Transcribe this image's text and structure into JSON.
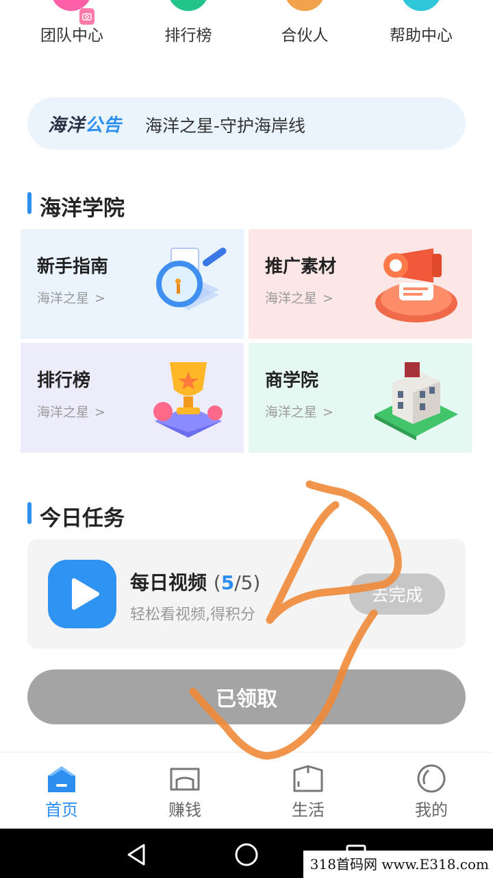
{
  "top_nav": {
    "items": [
      {
        "label": "团队中心",
        "color": "#ff5fa6"
      },
      {
        "label": "排行榜",
        "color": "#22c48a"
      },
      {
        "label": "合伙人",
        "color": "#f2a24a"
      },
      {
        "label": "帮助中心",
        "color": "#2ec6d8"
      }
    ],
    "badge_icon": "camera-badge-icon"
  },
  "notice": {
    "brand_part1": "海洋",
    "brand_part2": "公告",
    "text": "海洋之星-守护海岸线"
  },
  "academy": {
    "title": "海洋学院",
    "cards": [
      {
        "title": "新手指南",
        "sub": "海洋之星",
        "bg": "#eaf4fd",
        "icon": "magnifier-document-icon"
      },
      {
        "title": "推广素材",
        "sub": "海洋之星",
        "bg": "#fde6e6",
        "icon": "megaphone-icon"
      },
      {
        "title": "排行榜",
        "sub": "海洋之星",
        "bg": "#ececfb",
        "icon": "trophy-icon"
      },
      {
        "title": "商学院",
        "sub": "海洋之星",
        "bg": "#e5f8f1",
        "icon": "building-icon"
      }
    ],
    "chevron": ">"
  },
  "tasks": {
    "title": "今日任务",
    "item": {
      "title": "每日视频",
      "count_open": "(",
      "count_done": "5",
      "count_rest": "/5)",
      "sub": "轻松看视频,得积分",
      "button": "去完成",
      "icon": "play-icon"
    },
    "claim_button": "已领取"
  },
  "tabbar": {
    "items": [
      {
        "label": "首页",
        "icon": "home-icon",
        "active": true
      },
      {
        "label": "赚钱",
        "icon": "wallet-icon",
        "active": false
      },
      {
        "label": "生活",
        "icon": "life-icon",
        "active": false
      },
      {
        "label": "我的",
        "icon": "profile-icon",
        "active": false
      }
    ]
  },
  "system_nav": {
    "back": "back-icon",
    "home": "home-circle-icon",
    "recents": "recents-icon"
  },
  "watermark": "318首码网  www.E318.com",
  "colors": {
    "accent": "#2c8ff0",
    "scribble": "#f08a3a"
  }
}
